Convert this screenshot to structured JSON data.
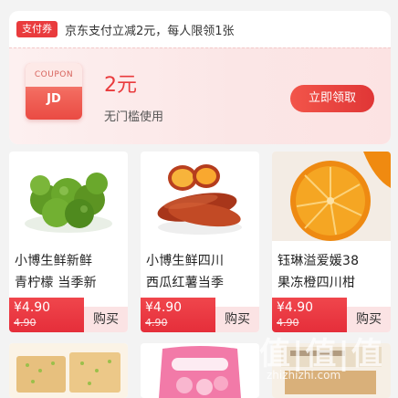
{
  "coupon": {
    "badge": "支付券",
    "description": "京东支付立减2元，每人限领1张",
    "ticket_label": "COUPON",
    "ticket_brand": "JD",
    "amount": "2元",
    "condition": "无门槛使用",
    "claim_label": "立即领取"
  },
  "products": [
    {
      "title_line1": "小博生鲜新鲜",
      "title_line2": "青柠檬 当季新",
      "price": "¥4.90",
      "old_price": "4.90",
      "buy_label": "购买",
      "image_icon": "lime-icon"
    },
    {
      "title_line1": "小博生鲜四川",
      "title_line2": "西瓜红薯当季",
      "price": "¥4.90",
      "old_price": "4.90",
      "buy_label": "购买",
      "image_icon": "sweet-potato-icon"
    },
    {
      "title_line1": "钰琳溢爱媛38",
      "title_line2": "果冻橙四川柑",
      "price": "¥4.90",
      "old_price": "4.90",
      "buy_label": "购买",
      "image_icon": "orange-icon"
    }
  ],
  "watermark": {
    "logo": "值|值|值",
    "domain": "zhizhizhi.com"
  },
  "colors": {
    "accent": "#e93b3d",
    "price_bg": "#e52e3a",
    "buy_bg": "#fbe3e4"
  }
}
